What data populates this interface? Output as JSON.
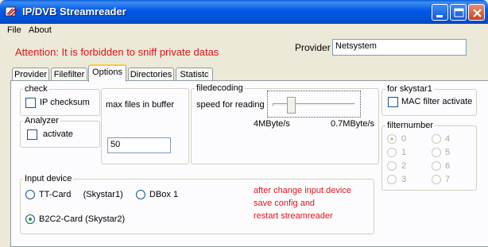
{
  "window": {
    "title": "IP/DVB Streamreader"
  },
  "menu": {
    "items": [
      "File",
      "About"
    ]
  },
  "attention": "Attention: It is forbidden to sniff private datas",
  "provider": {
    "label": "Provider",
    "value": "Netsystem"
  },
  "tabs": [
    "Provider",
    "Filefilter",
    "Options",
    "Directories",
    "Statistc"
  ],
  "active_tab": "Options",
  "check_group": {
    "title": "check",
    "ip_checksum_label": "IP checksum",
    "ip_checksum_checked": false
  },
  "analyzer_group": {
    "title": "Analyzer",
    "activate_label": "activate",
    "activate_checked": false
  },
  "buffer": {
    "label": "max files in  buffer",
    "value": "50"
  },
  "filedecoding": {
    "title": "filedecoding",
    "speed_label": "speed for reading",
    "min_label": "4MByte/s",
    "max_label": "0.7MByte/s",
    "slider_fraction": 0.2
  },
  "skystar": {
    "title": "for skystar1",
    "mac_filter_label": "MAC filter activate",
    "mac_filter_checked": false
  },
  "filternumber": {
    "title": "filternumber",
    "options": [
      "0",
      "1",
      "2",
      "3",
      "4",
      "5",
      "6",
      "7"
    ],
    "selected": "0",
    "disabled": true
  },
  "input_device": {
    "title": "Input device",
    "options": [
      "TT-Card     (Skystar1)",
      "DBox 1",
      "B2C2-Card (Skystar2)"
    ],
    "selected": "B2C2-Card (Skystar2)",
    "note_lines": [
      "after change input device",
      "save config and",
      "restart streamreader"
    ]
  },
  "colors": {
    "titlebar": "#0058e6",
    "warning_text": "#e2141a",
    "window_bg": "#ece9d8"
  }
}
